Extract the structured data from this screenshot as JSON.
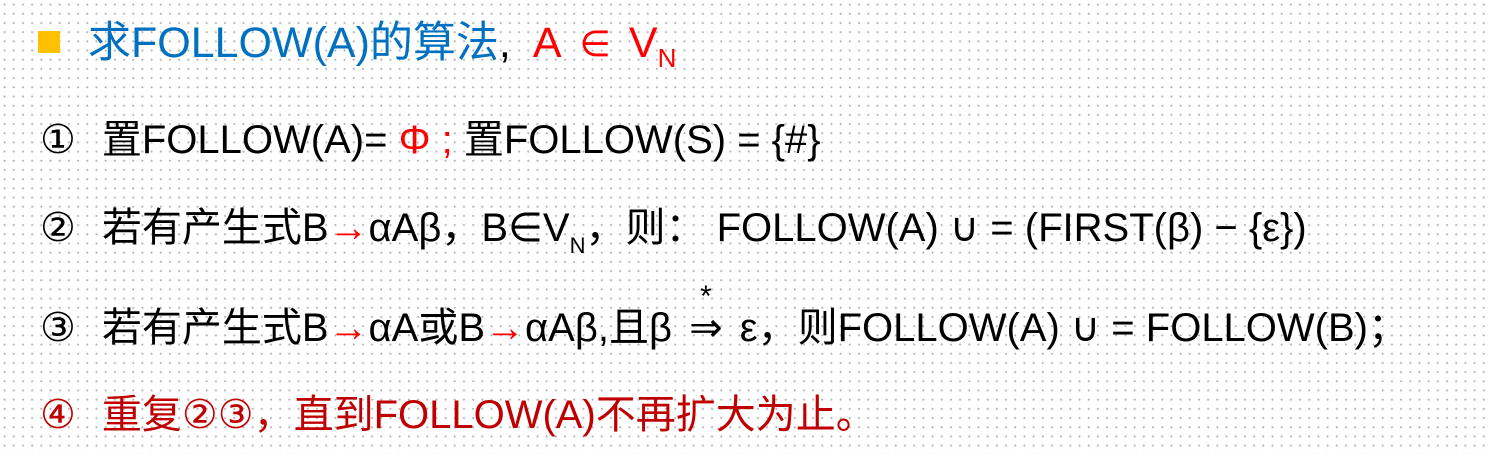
{
  "title": {
    "bullet_color": "#ffc000",
    "main_text": "求FOLLOW(A)的算法",
    "separator": ",",
    "cond_A": "A",
    "cond_in": "∈",
    "cond_V": "V",
    "cond_sub": "N"
  },
  "steps": {
    "s1": {
      "num": "①",
      "text1": "置FOLLOW(A)=",
      "phi": "Φ",
      "semi": ";",
      "text2": "置FOLLOW(S) = {#}"
    },
    "s2": {
      "num": "②",
      "text1": "若有产生式B",
      "arrow": "→",
      "text2": "αAβ，B∈V",
      "sub": "N",
      "text3": "，则： FOLLOW(A) ∪ = (FIRST(β) − {ε})"
    },
    "s3": {
      "num": "③",
      "text1": "若有产生式B",
      "arrow1": "→",
      "text2": "αA或B",
      "arrow2": "→",
      "text3": "αAβ,且β",
      "derive": "⇒",
      "star": "*",
      "text4": "ε，则FOLLOW(A) ∪ = FOLLOW(B)；"
    },
    "s4": {
      "num": "④",
      "text": "重复②③，直到FOLLOW(A)不再扩大为止。"
    }
  },
  "colors": {
    "title_blue": "#0070c0",
    "accent_red": "#ff0000",
    "step4_red": "#c00000",
    "text_black": "#000000"
  }
}
